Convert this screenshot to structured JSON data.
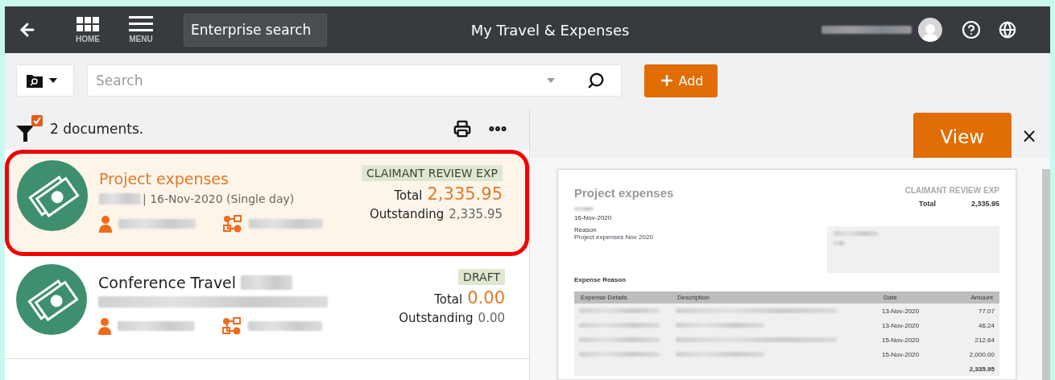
{
  "header": {
    "home_label": "HOME",
    "menu_label": "MENU",
    "enterprise_search": "Enterprise search",
    "title": "My Travel & Expenses"
  },
  "toolbar": {
    "search_placeholder": "Search",
    "add_button": "Add"
  },
  "list": {
    "count": "2 documents.",
    "documents": [
      {
        "title": "Project expenses",
        "title_suffix_redacted": false,
        "subtitle": "| 16-Nov-2020 (Single day)",
        "status": "CLAIMANT REVIEW EXP",
        "total_label": "Total",
        "total": "2,335.95",
        "outstanding_label": "Outstanding",
        "outstanding": "2,335.95",
        "selected": true
      },
      {
        "title": "Conference Travel",
        "title_suffix_redacted": true,
        "status": "DRAFT",
        "total_label": "Total",
        "total": "0.00",
        "outstanding_label": "Outstanding",
        "outstanding": "0.00",
        "selected": false
      }
    ]
  },
  "viewer": {
    "view_button": "View",
    "close": "×",
    "preview": {
      "title": "Project expenses",
      "status": "CLAIMANT REVIEW EXP",
      "total_label": "Total",
      "total": "2,335.95",
      "date": "16-Nov-2020",
      "reason_label": "Reason",
      "reason": "Project expenses Nov 2020",
      "section_label": "Expense Reason",
      "columns": [
        "Expense Details",
        "Description",
        "Date",
        "Amount"
      ],
      "rows": [
        {
          "date": "13-Nov-2020",
          "amount": "77.07"
        },
        {
          "date": "13-Nov-2020",
          "amount": "46.24"
        },
        {
          "date": "15-Nov-2020",
          "amount": "212.64"
        },
        {
          "date": "15-Nov-2020",
          "amount": "2,000.00"
        }
      ],
      "grand_total": "2,335.95"
    }
  }
}
